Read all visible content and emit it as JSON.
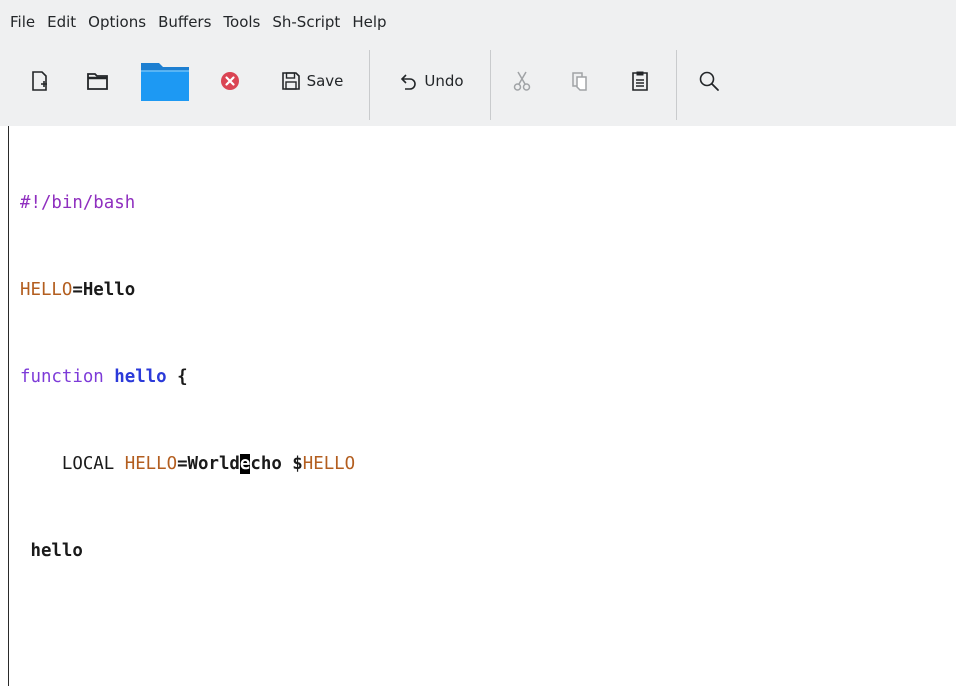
{
  "menu": {
    "items": [
      "File",
      "Edit",
      "Options",
      "Buffers",
      "Tools",
      "Sh-Script",
      "Help"
    ]
  },
  "toolbar": {
    "new_file_icon": "new-file-icon",
    "open_directory_icon": "folder-open-icon",
    "open_file_icon": "folder-blue-icon",
    "close_icon": "close-circle-icon",
    "save_label": "Save",
    "undo_label": "Undo",
    "cut_icon": "scissors-icon",
    "copy_icon": "copy-icon",
    "paste_icon": "paste-icon",
    "search_icon": "search-icon"
  },
  "editor": {
    "line1": "#!/bin/bash",
    "line2_var": "HELLO",
    "line2_rest": "=Hello",
    "line3_kw": "function",
    "line3_fn": "hello",
    "line3_brace": " {",
    "line4_indent": "    ",
    "line4_local": "LOCAL ",
    "line4_var": "HELLO",
    "line4_eq": "=World",
    "line4_cursor": "e",
    "line4_rest": "cho $",
    "line4_var2": "HELLO",
    "line5": " hello"
  },
  "colors": {
    "shebang": "#8f2fbf",
    "variable": "#b35e1f",
    "keyword": "#7d3bd8",
    "function_name": "#2b3ad9",
    "toolbar_bg": "#eff0f1",
    "close_red": "#da4453",
    "folder_blue": "#1d99f3"
  }
}
